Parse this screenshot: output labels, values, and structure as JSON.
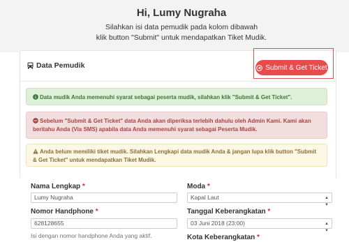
{
  "header": {
    "greeting": "Hi, Lumy Nugraha",
    "intro_line1": "Silahkan isi data pemudik pada kolom dibawah",
    "intro_line2": "klik button \"Submit\" untuk mendapatkan Tiket Mudik."
  },
  "card": {
    "title": "Data Pemudik",
    "title_icon": "bus-icon",
    "submit_label": "Submit & Get Ticket",
    "submit_icon": "arrow-circle-icon"
  },
  "alerts": {
    "success_text": "Data mudik Anda memenuhi syarat sebagai peserta mudik, silahkan klik \"Submit & Get Ticket\".",
    "danger_text": "Sebelum \"Submit & Get Ticket\" data Anda akan diperiksa terlebih dahulu oleh Admin Kami. Kami akan beritahu Anda (Via SMS) apabila data Anda memenuhi syarat sebagai Peserta Mudik.",
    "warning_text": "Anda belum memiliki tiket mudik. Silahkan Lengkapi data mudik Anda & jangan lupa klik button \"Submit & Get Ticket\" untuk mendapatkan Tiket Mudik."
  },
  "form": {
    "nama_label": "Nama Lengkap",
    "nama_value": "Lumy Nugraha",
    "phone_label": "Nomor Handphone",
    "phone_value": "628128655",
    "phone_help": "Isi dengan nomor handphone Anda yang aktif.",
    "moda_label": "Moda",
    "moda_value": "Kapal Laut",
    "tanggal_label": "Tanggal Keberangkatan",
    "tanggal_value": "03 Juni 2018 (23:00)",
    "kota_label": "Kota Keberangkatan",
    "required_mark": "*"
  },
  "colors": {
    "accent_red": "#e74c4c",
    "success_bg": "#dff0d8",
    "danger_bg": "#f2dede",
    "warning_bg": "#fcf8e3"
  }
}
